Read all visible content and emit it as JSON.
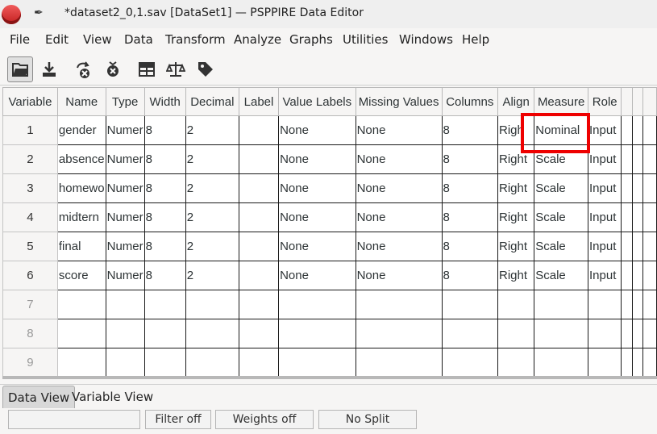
{
  "window": {
    "title": "*dataset2_0,1.sav [DataSet1] — PSPPIRE Data Editor"
  },
  "menu": [
    "File",
    "Edit",
    "View",
    "Data",
    "Transform",
    "Analyze",
    "Graphs",
    "Utilities",
    "Windows",
    "Help"
  ],
  "toolbar": {
    "icons": [
      "open-icon",
      "save-icon",
      "goto-case-icon",
      "goto-variable-icon",
      "split-file-icon",
      "weight-cases-icon",
      "value-labels-icon"
    ]
  },
  "grid": {
    "headers": [
      "Variable",
      "Name",
      "Type",
      "Width",
      "Decimal",
      "Label",
      "Value Labels",
      "Missing Values",
      "Columns",
      "Align",
      "Measure",
      "Role"
    ],
    "rows": [
      {
        "num": "1",
        "name": "gender",
        "type": "Numer",
        "width": "8",
        "decimal": "2",
        "label": "",
        "value_labels": "None",
        "missing": "None",
        "columns": "8",
        "align": "Righ",
        "measure": "Nominal",
        "role": "Input"
      },
      {
        "num": "2",
        "name": "absence",
        "type": "Numer",
        "width": "8",
        "decimal": "2",
        "label": "",
        "value_labels": "None",
        "missing": "None",
        "columns": "8",
        "align": "Right",
        "measure": "Scale",
        "role": "Input"
      },
      {
        "num": "3",
        "name": "homewo",
        "type": "Numer",
        "width": "8",
        "decimal": "2",
        "label": "",
        "value_labels": "None",
        "missing": "None",
        "columns": "8",
        "align": "Right",
        "measure": "Scale",
        "role": "Input"
      },
      {
        "num": "4",
        "name": "midtern",
        "type": "Numer",
        "width": "8",
        "decimal": "2",
        "label": "",
        "value_labels": "None",
        "missing": "None",
        "columns": "8",
        "align": "Right",
        "measure": "Scale",
        "role": "Input"
      },
      {
        "num": "5",
        "name": "final",
        "type": "Numer",
        "width": "8",
        "decimal": "2",
        "label": "",
        "value_labels": "None",
        "missing": "None",
        "columns": "8",
        "align": "Right",
        "measure": "Scale",
        "role": "Input"
      },
      {
        "num": "6",
        "name": "score",
        "type": "Numer",
        "width": "8",
        "decimal": "2",
        "label": "",
        "value_labels": "None",
        "missing": "None",
        "columns": "8",
        "align": "Right",
        "measure": "Scale",
        "role": "Input"
      }
    ],
    "empty_rows": [
      "7",
      "8",
      "9"
    ]
  },
  "tabs": [
    "Data View",
    "Variable View"
  ],
  "status": {
    "filter": "Filter off",
    "weights": "Weights off",
    "split": "No Split"
  },
  "colors": {
    "highlight": "#ee0000"
  }
}
